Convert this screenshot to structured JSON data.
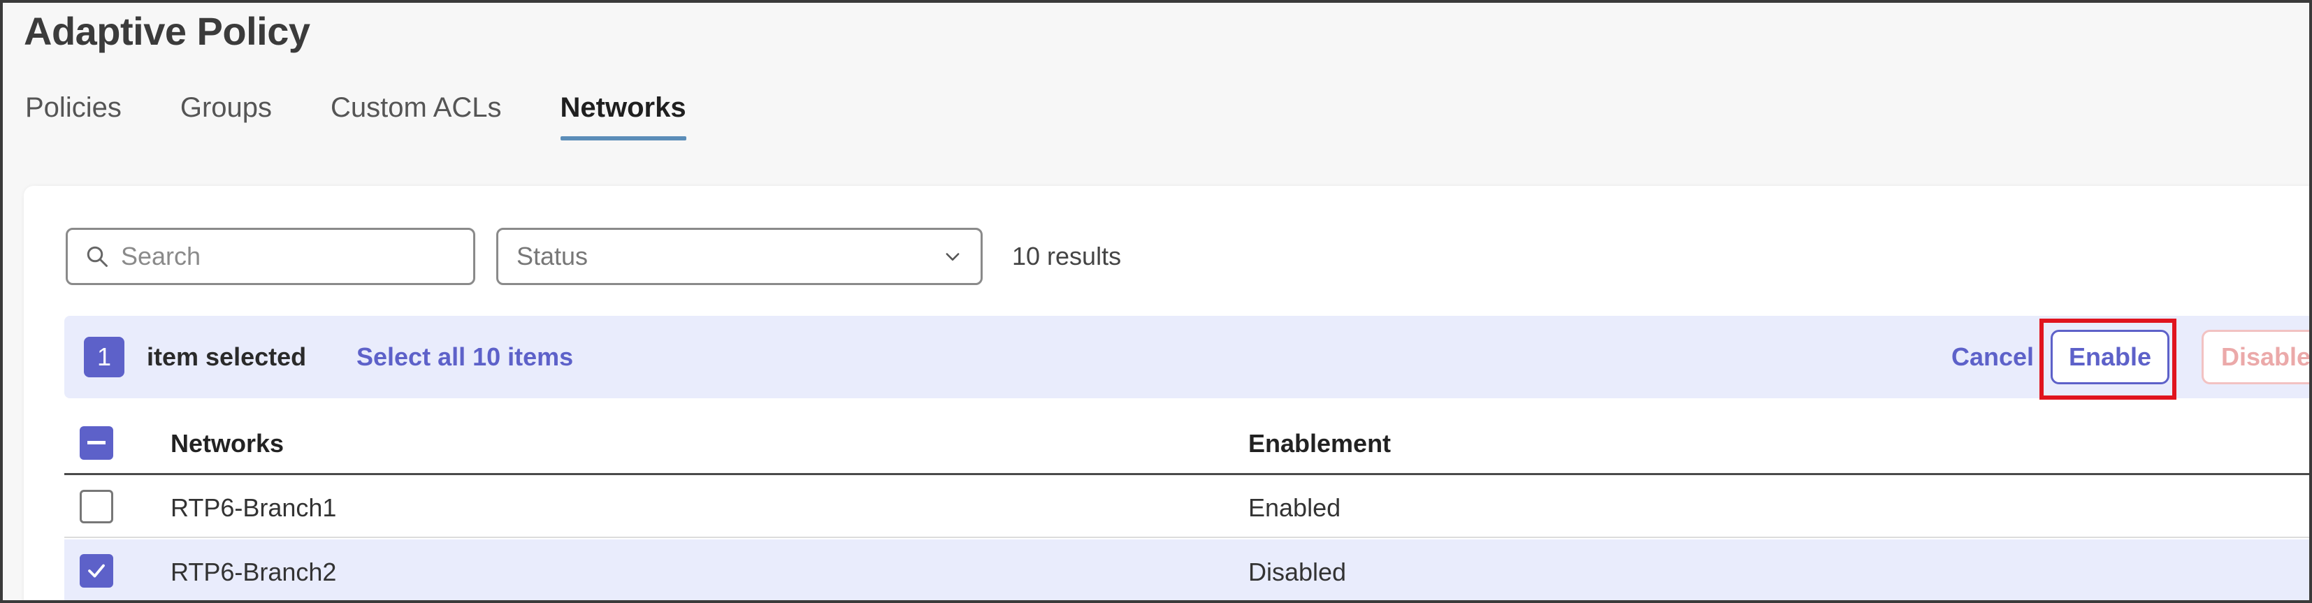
{
  "page": {
    "title": "Adaptive Policy"
  },
  "tabs": [
    {
      "label": "Policies",
      "active": false
    },
    {
      "label": "Groups",
      "active": false
    },
    {
      "label": "Custom ACLs",
      "active": false
    },
    {
      "label": "Networks",
      "active": true
    }
  ],
  "filters": {
    "search_placeholder": "Search",
    "status_label": "Status",
    "results_text": "10 results"
  },
  "selection": {
    "count": "1",
    "text": "item selected",
    "select_all_label": "Select all 10 items",
    "cancel_label": "Cancel",
    "enable_label": "Enable",
    "disable_label": "Disable"
  },
  "table": {
    "columns": [
      "Networks",
      "Enablement"
    ],
    "rows": [
      {
        "network": "RTP6-Branch1",
        "enablement": "Enabled",
        "checked": false
      },
      {
        "network": "RTP6-Branch2",
        "enablement": "Disabled",
        "checked": true
      }
    ]
  },
  "colors": {
    "accent": "#5d61c9",
    "tab_underline": "#5b8db8",
    "highlight": "#e0141e",
    "selection_bg": "#e9ecfc"
  }
}
